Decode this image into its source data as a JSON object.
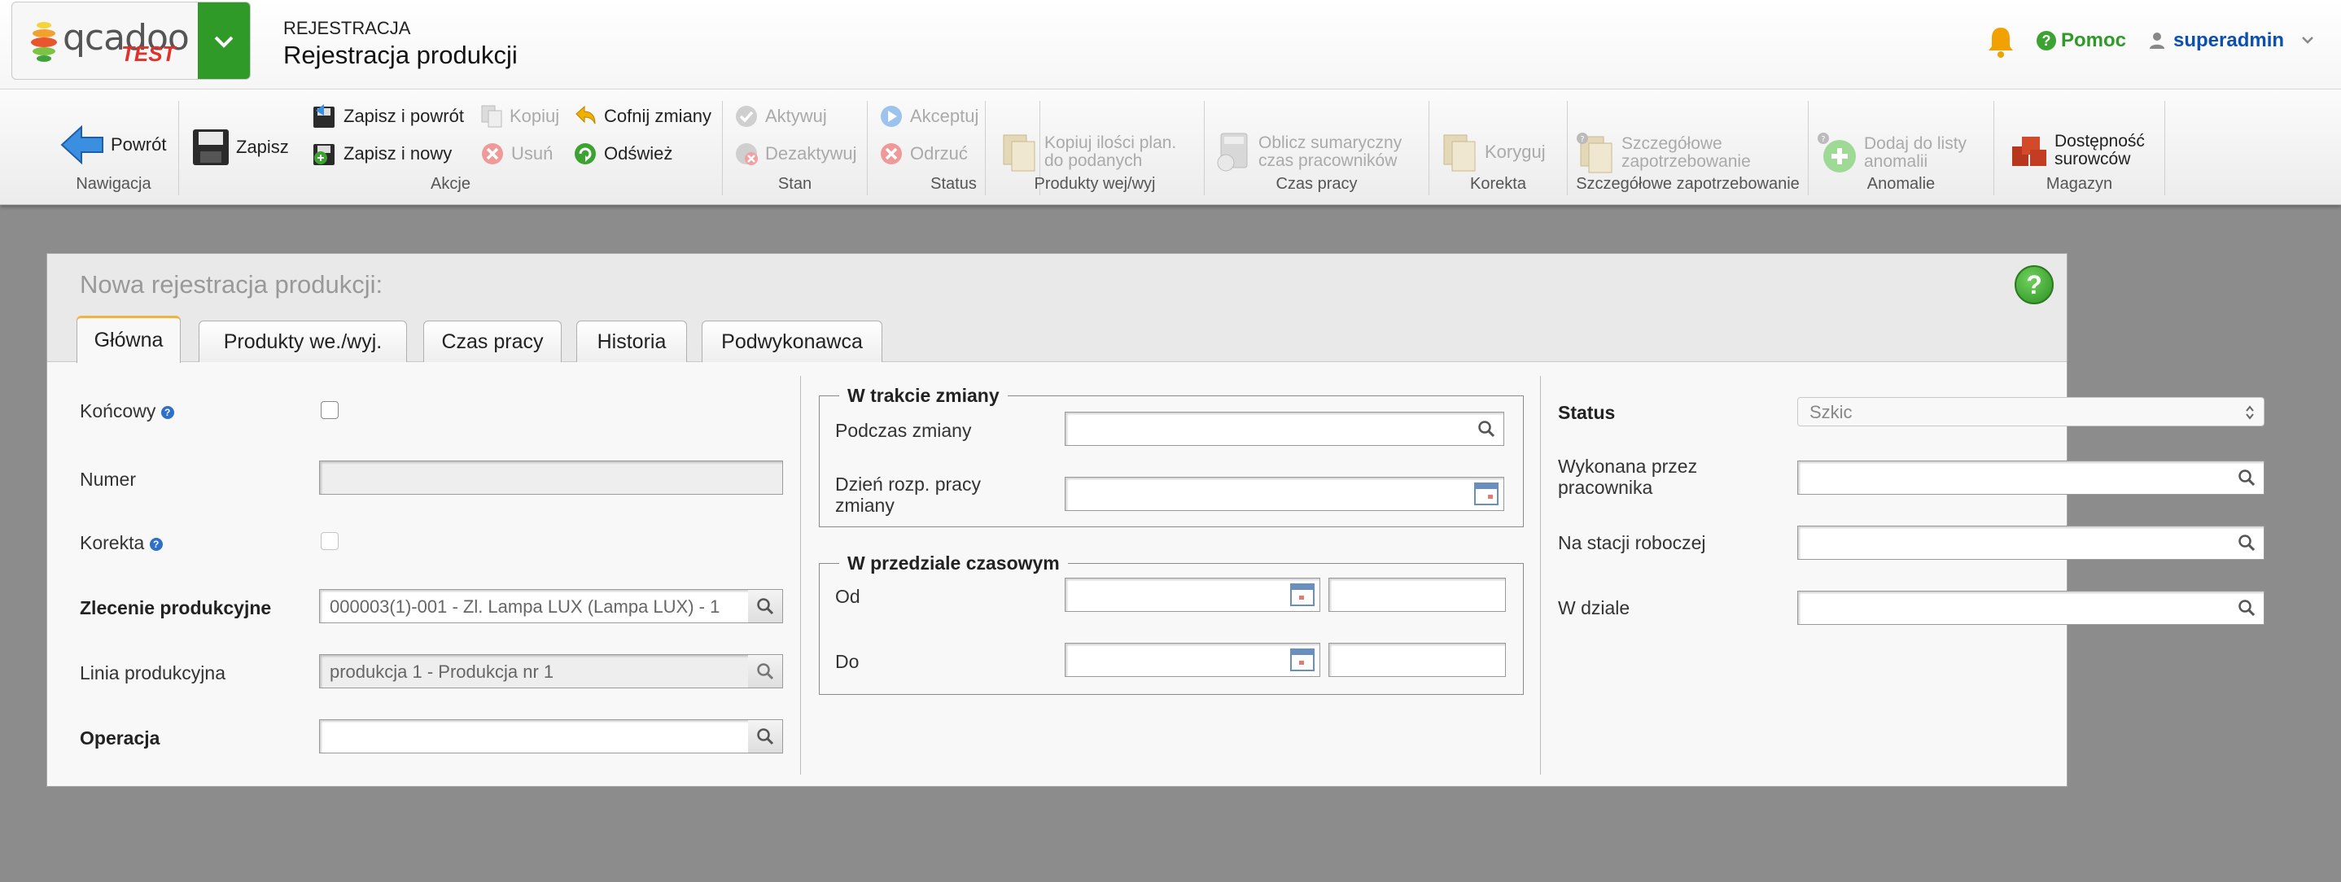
{
  "header": {
    "logo_text": "qcadoo",
    "logo_badge": "TEST",
    "module": "REJESTRACJA",
    "title": "Rejestracja produkcji",
    "help_label": "Pomoc",
    "user_label": "superadmin",
    "colors": {
      "accent_green": "#2f9a28",
      "user_blue": "#0b4fb0",
      "bell_orange": "#f2a200"
    }
  },
  "ribbon": {
    "groups": [
      {
        "label": "Nawigacja",
        "buttons": [
          {
            "label": "Powrót",
            "icon": "back-arrow-icon"
          }
        ]
      },
      {
        "label": "Akcje",
        "buttons": [
          {
            "label": "Zapisz",
            "icon": "save-icon"
          },
          {
            "label": "Zapisz i powrót",
            "icon": "save-back-icon"
          },
          {
            "label": "Zapisz i nowy",
            "icon": "save-new-icon"
          },
          {
            "label": "Kopiuj",
            "icon": "copy-icon",
            "disabled": true
          },
          {
            "label": "Usuń",
            "icon": "delete-icon",
            "disabled": true
          },
          {
            "label": "Cofnij zmiany",
            "icon": "undo-icon"
          },
          {
            "label": "Odśwież",
            "icon": "refresh-icon"
          }
        ]
      },
      {
        "label": "Stan",
        "buttons": [
          {
            "label": "Aktywuj",
            "icon": "activate-icon",
            "disabled": true
          },
          {
            "label": "Dezaktywuj",
            "icon": "deactivate-icon",
            "disabled": true
          }
        ]
      },
      {
        "label": "Status",
        "buttons": [
          {
            "label": "Akceptuj",
            "icon": "accept-icon",
            "disabled": true
          },
          {
            "label": "Odrzuć",
            "icon": "reject-icon",
            "disabled": true
          }
        ]
      },
      {
        "label": "Produkty wej/wyj",
        "buttons": [
          {
            "label_line1": "Kopiuj ilości plan.",
            "label_line2": "do podanych",
            "icon": "copy-quantities-icon",
            "disabled": true
          }
        ]
      },
      {
        "label": "Czas pracy",
        "buttons": [
          {
            "label_line1": "Oblicz sumaryczny",
            "label_line2": "czas pracowników",
            "icon": "calculator-icon",
            "disabled": true
          }
        ]
      },
      {
        "label": "Korekta",
        "buttons": [
          {
            "label": "Koryguj",
            "icon": "correct-icon",
            "disabled": true
          }
        ]
      },
      {
        "label": "Szczegółowe zapotrzebowanie",
        "buttons": [
          {
            "label_line1": "Szczegółowe",
            "label_line2": "zapotrzebowanie",
            "icon": "detailed-demand-icon",
            "disabled": true
          }
        ]
      },
      {
        "label": "Anomalie",
        "buttons": [
          {
            "label_line1": "Dodaj do listy",
            "label_line2": "anomalii",
            "icon": "add-anomaly-icon",
            "disabled": true
          }
        ]
      },
      {
        "label": "Magazyn",
        "buttons": [
          {
            "label_line1": "Dostępność",
            "label_line2": "surowców",
            "icon": "warehouse-icon"
          }
        ]
      }
    ]
  },
  "form": {
    "title": "Nowa rejestracja produkcji:",
    "tabs": [
      {
        "label": "Główna",
        "active": true
      },
      {
        "label": "Produkty we./wyj."
      },
      {
        "label": "Czas pracy"
      },
      {
        "label": "Historia"
      },
      {
        "label": "Podwykonawca"
      }
    ],
    "left": {
      "koncowy_label": "Końcowy",
      "numer_label": "Numer",
      "numer_value": "",
      "korekta_label": "Korekta",
      "zlecenie_label": "Zlecenie produkcyjne",
      "zlecenie_value": "000003(1)-001 - Zl. Lampa LUX (Lampa LUX) - 1",
      "linia_label": "Linia produkcyjna",
      "linia_value": "produkcja 1 - Produkcja nr 1",
      "operacja_label": "Operacja",
      "operacja_value": ""
    },
    "middle": {
      "shift_legend": "W trakcie zmiany",
      "podczas_label": "Podczas zmiany",
      "dzien_label_line1": "Dzień rozp. pracy",
      "dzien_label_line2": "zmiany",
      "range_legend": "W przedziale czasowym",
      "od_label": "Od",
      "do_label": "Do"
    },
    "right": {
      "status_label": "Status",
      "status_value": "Szkic",
      "wykonana_label_line1": "Wykonana przez",
      "wykonana_label_line2": "pracownika",
      "stacja_label": "Na stacji roboczej",
      "dzial_label": "W dziale"
    }
  }
}
